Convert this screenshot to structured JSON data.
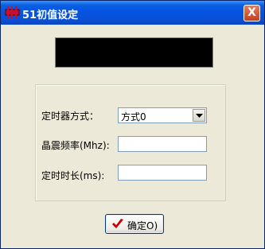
{
  "window": {
    "title": "51初值设定",
    "close_label": "X"
  },
  "form": {
    "timer_mode_label": "定时器方式：",
    "timer_mode_value": "方式0",
    "crystal_freq_label": "晶震频率(Mhz):",
    "crystal_freq_value": "",
    "timer_duration_label": "定时时长(ms):",
    "timer_duration_value": ""
  },
  "buttons": {
    "ok_label": "确定O)"
  },
  "colors": {
    "titlebar": "#0554e3",
    "display_panel": "#000000",
    "dialog_background": "#ece9d8",
    "check_icon": "#c80000"
  }
}
